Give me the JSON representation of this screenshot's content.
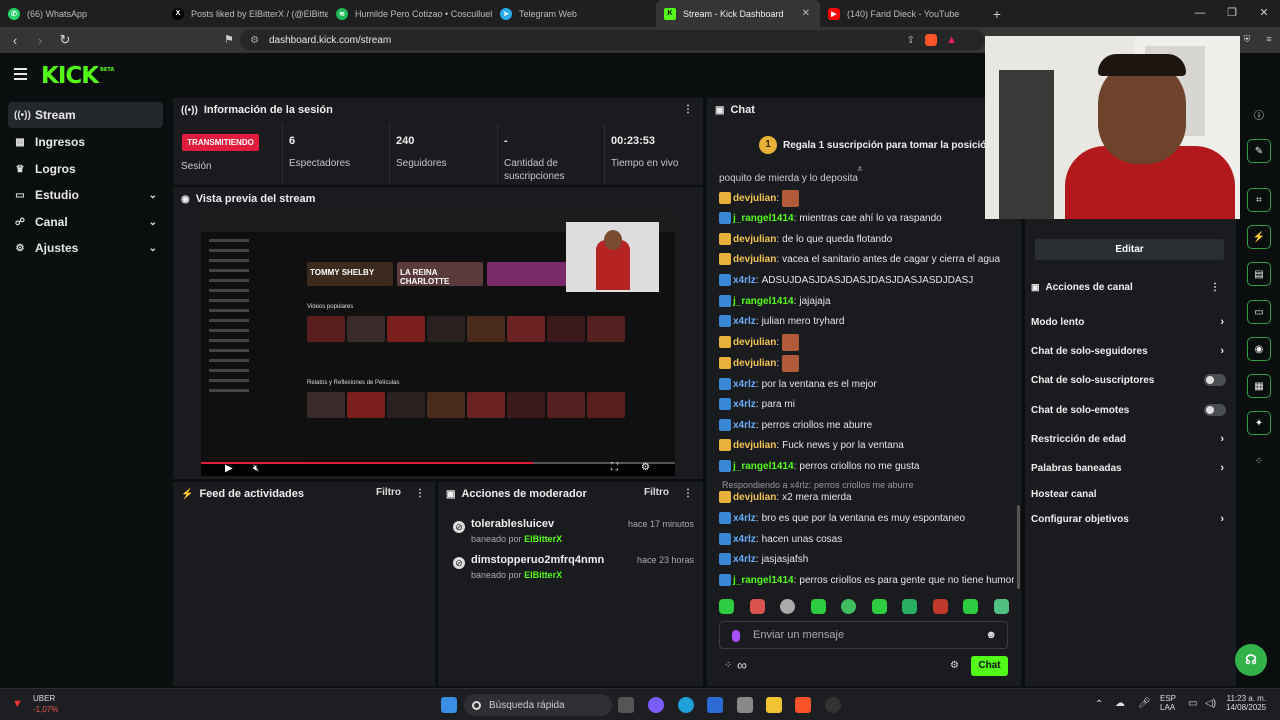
{
  "browser": {
    "tabs": [
      {
        "title": "(66) WhatsApp",
        "favicon": "whatsapp-icon",
        "color": "#25d366",
        "active": false
      },
      {
        "title": "Posts liked by ElBitterX / (@ElBitter…",
        "favicon": "x-icon",
        "color": "#000000",
        "active": false
      },
      {
        "title": "Humilde Pero Cotizao • Cosculluela",
        "favicon": "spotify-icon",
        "color": "#1db954",
        "active": false
      },
      {
        "title": "Telegram Web",
        "favicon": "telegram-icon",
        "color": "#2aabee",
        "active": false
      },
      {
        "title": "Stream - Kick Dashboard",
        "favicon": "kick-icon",
        "color": "#53fc18",
        "active": true
      },
      {
        "title": "(140) Farid Dieck - YouTube",
        "favicon": "youtube-icon",
        "color": "#ff0000",
        "active": false
      }
    ],
    "new_tab": "+",
    "url": "dashboard.kick.com/stream"
  },
  "kick": {
    "logo": "KICK",
    "logo_badge": "BETA"
  },
  "sidebar": {
    "items": [
      {
        "label": "Stream",
        "icon": "stream-icon",
        "active": true,
        "expandable": false
      },
      {
        "label": "Ingresos",
        "icon": "income-icon",
        "active": false,
        "expandable": false
      },
      {
        "label": "Logros",
        "icon": "trophy-icon",
        "active": false,
        "expandable": false
      },
      {
        "label": "Estudio",
        "icon": "studio-icon",
        "active": false,
        "expandable": true
      },
      {
        "label": "Canal",
        "icon": "channel-icon",
        "active": false,
        "expandable": true
      },
      {
        "label": "Ajustes",
        "icon": "gear-icon",
        "active": false,
        "expandable": true
      }
    ]
  },
  "session": {
    "title": "Información de la sesión",
    "status": "TRANSMITIENDO",
    "status_label": "Sesión",
    "stats": [
      {
        "value": "6",
        "label": "Espectadores"
      },
      {
        "value": "240",
        "label": "Seguidores"
      },
      {
        "value": "-",
        "label": "Cantidad de suscripciones"
      },
      {
        "value": "00:23:53",
        "label": "Tiempo en vivo"
      }
    ]
  },
  "preview": {
    "title": "Vista previa del stream",
    "inner_cards": [
      "TOMMY SHELBY",
      "LA REINA CHARLOTTE"
    ],
    "section_titles": [
      "Videos populares",
      "Relatos y Reflexiones de Películas"
    ]
  },
  "activity": {
    "title": "Feed de actividades",
    "filter": "Filtro"
  },
  "moderator": {
    "title": "Acciones de moderador",
    "filter": "Filtro",
    "items": [
      {
        "user": "tolerablesluicev",
        "action": "baneado por",
        "by": "ElBitterX",
        "time": "hace 17 minutos"
      },
      {
        "user": "dimstopperuo2mfrq4nmn",
        "action": "baneado por",
        "by": "ElBitterX",
        "time": "hace 23 horas"
      }
    ]
  },
  "chat": {
    "title": "Chat",
    "pinned_rank": "1",
    "pinned": "Regala 1 suscripción para tomar la posición 1",
    "partial_top": "poquito de mierda y lo deposita",
    "messages": [
      {
        "user": "devjulian",
        "text": "",
        "emote": true,
        "badge": "crown"
      },
      {
        "user": "j_rangel1414",
        "text": "mientras cae ahí lo va raspando",
        "badge": "sword"
      },
      {
        "user": "devjulian",
        "text": "de lo que queda flotando",
        "badge": "crown"
      },
      {
        "user": "devjulian",
        "text": "vacea el sanitario antes de cagar y cierra el agua",
        "badge": "crown"
      },
      {
        "user": "x4rlz",
        "text": "ADSUJDASJDASJDASJDASJDASJASDJDASJ",
        "badge": "sword"
      },
      {
        "user": "j_rangel1414",
        "text": "jajajaja",
        "badge": "sword"
      },
      {
        "user": "x4rlz",
        "text": "julian mero tryhard",
        "badge": "sword"
      },
      {
        "user": "devjulian",
        "text": "",
        "emote": true,
        "badge": "crown"
      },
      {
        "user": "devjulian",
        "text": "",
        "emote": true,
        "badge": "crown"
      },
      {
        "user": "x4rlz",
        "text": "por la ventana es el mejor",
        "badge": "sword"
      },
      {
        "user": "x4rlz",
        "text": "para mi",
        "badge": "sword"
      },
      {
        "user": "x4rlz",
        "text": "perros criollos me aburre",
        "badge": "sword"
      },
      {
        "user": "devjulian",
        "text": "Fuck news y por la ventana",
        "badge": "crown"
      },
      {
        "user": "j_rangel1414",
        "text": "perros criollos no me gusta",
        "badge": "sword"
      },
      {
        "reply": "Respondiendo a x4rlz: perros criollos me aburre",
        "user": "devjulian",
        "text": "x2 mera mierda",
        "badge": "crown"
      },
      {
        "user": "x4rlz",
        "text": "bro es que por la ventana es muy espontaneo",
        "badge": "sword"
      },
      {
        "user": "x4rlz",
        "text": "hacen unas cosas",
        "badge": "sword"
      },
      {
        "user": "x4rlz",
        "text": "jasjasjafsh",
        "badge": "sword"
      },
      {
        "user": "j_rangel1414",
        "text": "perros criollos es para gente que no tiene humor",
        "badge": "sword"
      }
    ],
    "input_placeholder": "Enviar un mensaje",
    "send_label": "Chat",
    "infinity": "∞"
  },
  "channel_actions": {
    "edit_label": "Editar",
    "title": "Acciones de canal",
    "items": [
      {
        "label": "Modo lento",
        "type": "chevron"
      },
      {
        "label": "Chat de solo-seguidores",
        "type": "chevron"
      },
      {
        "label": "Chat de solo-suscriptores",
        "type": "toggle"
      },
      {
        "label": "Chat de solo-emotes",
        "type": "toggle"
      },
      {
        "label": "Restricción de edad",
        "type": "chevron"
      },
      {
        "label": "Palabras baneadas",
        "type": "chevron"
      },
      {
        "label": "Hostear canal",
        "type": "none"
      },
      {
        "label": "Configurar objetivos",
        "type": "chevron"
      }
    ]
  },
  "taskbar": {
    "ticker_name": "UBER",
    "ticker_change": "-1,07%",
    "search_placeholder": "Búsqueda rápida",
    "lang": "ESP",
    "region": "LAA",
    "time": "11:23 a. m.",
    "date": "14/08/2025"
  },
  "colors": {
    "accent": "#53fc18",
    "live": "#e31b3c",
    "panel": "#191b1f",
    "bg": "#0b0e0f"
  }
}
